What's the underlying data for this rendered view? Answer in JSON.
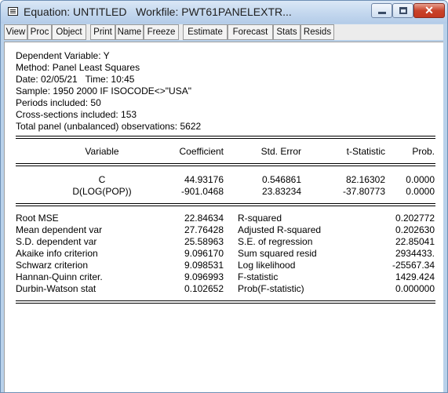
{
  "window": {
    "title": "Equation: UNTITLED   Workfile: PWT61PANELEXTR...",
    "close_glyph": "✕"
  },
  "toolbar": [
    "View",
    "Proc",
    "Object",
    "Print",
    "Name",
    "Freeze",
    "Estimate",
    "Forecast",
    "Stats",
    "Resids"
  ],
  "header": {
    "dependent": "Dependent Variable: Y",
    "method": "Method: Panel Least Squares",
    "date": "Date: 02/05/21   Time: 10:45",
    "sample": "Sample: 1950 2000 IF ISOCODE<>\"USA\"",
    "periods": "Periods included: 50",
    "cross_sections": "Cross-sections included: 153",
    "observations": "Total panel (unbalanced) observations: 5622"
  },
  "coef_table": {
    "columns": [
      "Variable",
      "Coefficient",
      "Std. Error",
      "t-Statistic",
      "Prob."
    ],
    "rows": [
      [
        "C",
        "44.93176",
        "0.546861",
        "82.16302",
        "0.0000"
      ],
      [
        "D(LOG(POP))",
        "-901.0468",
        "23.83234",
        "-37.80773",
        "0.0000"
      ]
    ]
  },
  "stats": [
    [
      "Root MSE",
      "22.84634",
      "R-squared",
      "0.202772"
    ],
    [
      "Mean dependent var",
      "27.76428",
      "Adjusted R-squared",
      "0.202630"
    ],
    [
      "S.D. dependent var",
      "25.58963",
      "S.E. of regression",
      "22.85041"
    ],
    [
      "Akaike info criterion",
      "9.096170",
      "Sum squared resid",
      "2934433."
    ],
    [
      "Schwarz criterion",
      "9.098531",
      "Log likelihood",
      "-25567.34"
    ],
    [
      "Hannan-Quinn criter.",
      "9.096993",
      "F-statistic",
      "1429.424"
    ],
    [
      "Durbin-Watson stat",
      "0.102652",
      "Prob(F-statistic)",
      "0.000000"
    ]
  ],
  "colors": {
    "title_bg": "#c3d7ee",
    "close_button": "#c8432a",
    "toolbar_bg": "#ececec"
  }
}
